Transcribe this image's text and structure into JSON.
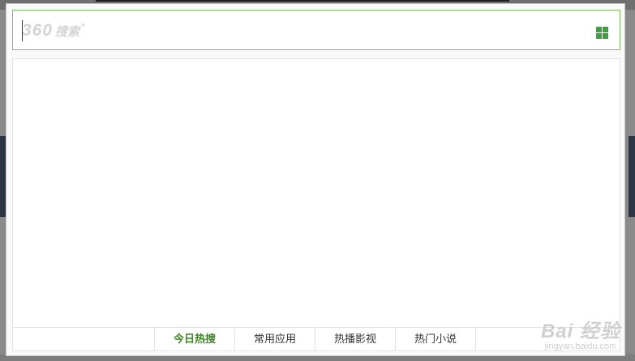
{
  "search": {
    "logo_text": "360",
    "logo_suffix": "搜索",
    "logo_star": "*",
    "grid_icon": "grid-apps-icon"
  },
  "tabs": [
    {
      "label": "今日热搜",
      "active": true
    },
    {
      "label": "常用应用",
      "active": false
    },
    {
      "label": "热播影视",
      "active": false
    },
    {
      "label": "热门小说",
      "active": false
    }
  ],
  "watermark": {
    "main": "Bai 经验",
    "sub": "jingyan.baidu.com"
  },
  "colors": {
    "accent": "#7dc15f",
    "active_tab": "#3a8a1e",
    "grid_icon": "#3aa33a"
  }
}
